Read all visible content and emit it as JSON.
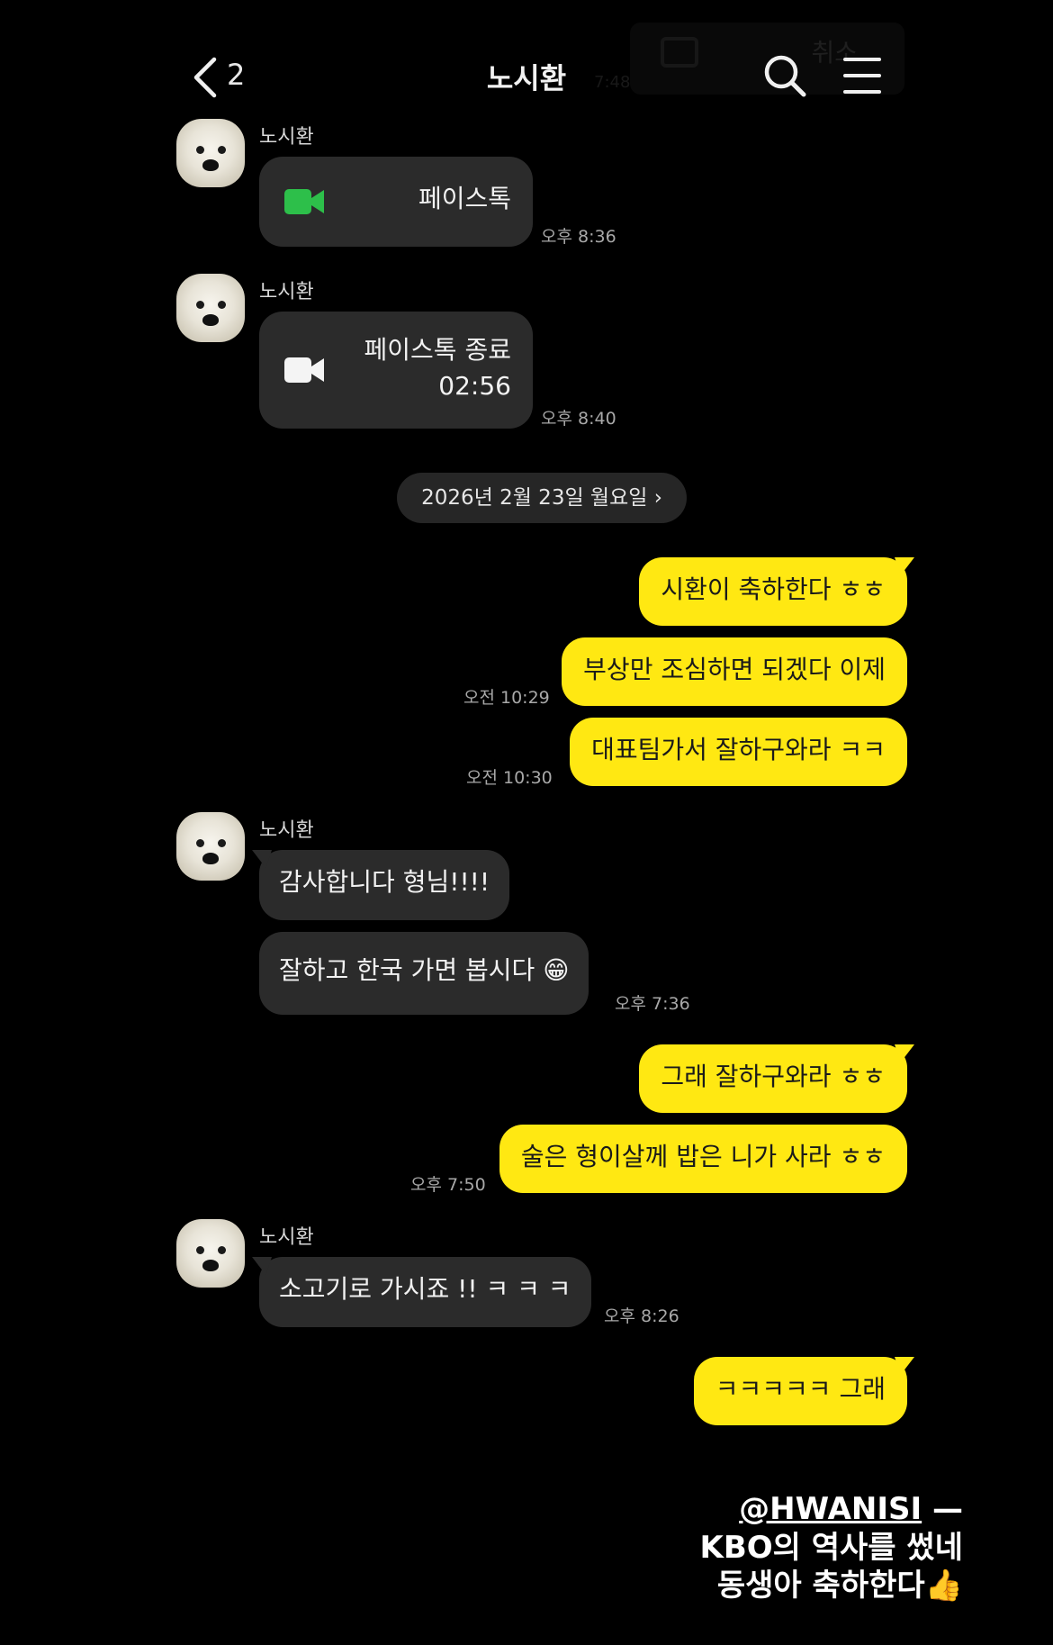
{
  "header": {
    "back_count": "2",
    "title": "노시환",
    "ghost_label": "취소",
    "ghost_time": "7:48"
  },
  "date_separator": "2026년 2월 23일 월요일",
  "date_separator_chevron": "›",
  "messages": [
    {
      "sender": "노시환",
      "type": "facetalk",
      "label": "페이스톡",
      "time": "오후 8:36",
      "icon_color": "#2dbf4a"
    },
    {
      "sender": "노시환",
      "type": "facetalk_end",
      "label": "페이스톡 종료",
      "duration": "02:56",
      "time": "오후 8:40"
    },
    {
      "type": "out",
      "text": "시환이 축하한다 ㅎㅎ"
    },
    {
      "type": "out",
      "text": "부상만 조심하면 되겠다 이제",
      "time": "오전 10:29"
    },
    {
      "type": "out",
      "text": "대표팀가서 잘하구와라 ㅋㅋ",
      "time": "오전 10:30"
    },
    {
      "sender": "노시환",
      "type": "in",
      "text": "감사합니다 형님!!!!"
    },
    {
      "type": "in",
      "text": "잘하고 한국 가면 봅시다 😁",
      "time": "오후 7:36"
    },
    {
      "type": "out",
      "text": "그래 잘하구와라 ㅎㅎ"
    },
    {
      "type": "out",
      "text": "술은 형이살께 밥은 니가 사라 ㅎㅎ",
      "time": "오후 7:50"
    },
    {
      "sender": "노시환",
      "type": "in",
      "text": "소고기로 가시죠 !! ㅋ ㅋ ㅋ",
      "time": "오후 8:26"
    },
    {
      "type": "out",
      "text": "ㅋㅋㅋㅋㅋ 그래"
    }
  ],
  "caption": {
    "handle": "@HWANISI",
    "dash": " —",
    "line1": "KBO의 역사를 썼네",
    "line2": "동생아 축하한다👍"
  },
  "colors": {
    "background": "#000000",
    "outgoing_bubble": "#ffe812",
    "incoming_bubble": "#2b2b2b"
  }
}
